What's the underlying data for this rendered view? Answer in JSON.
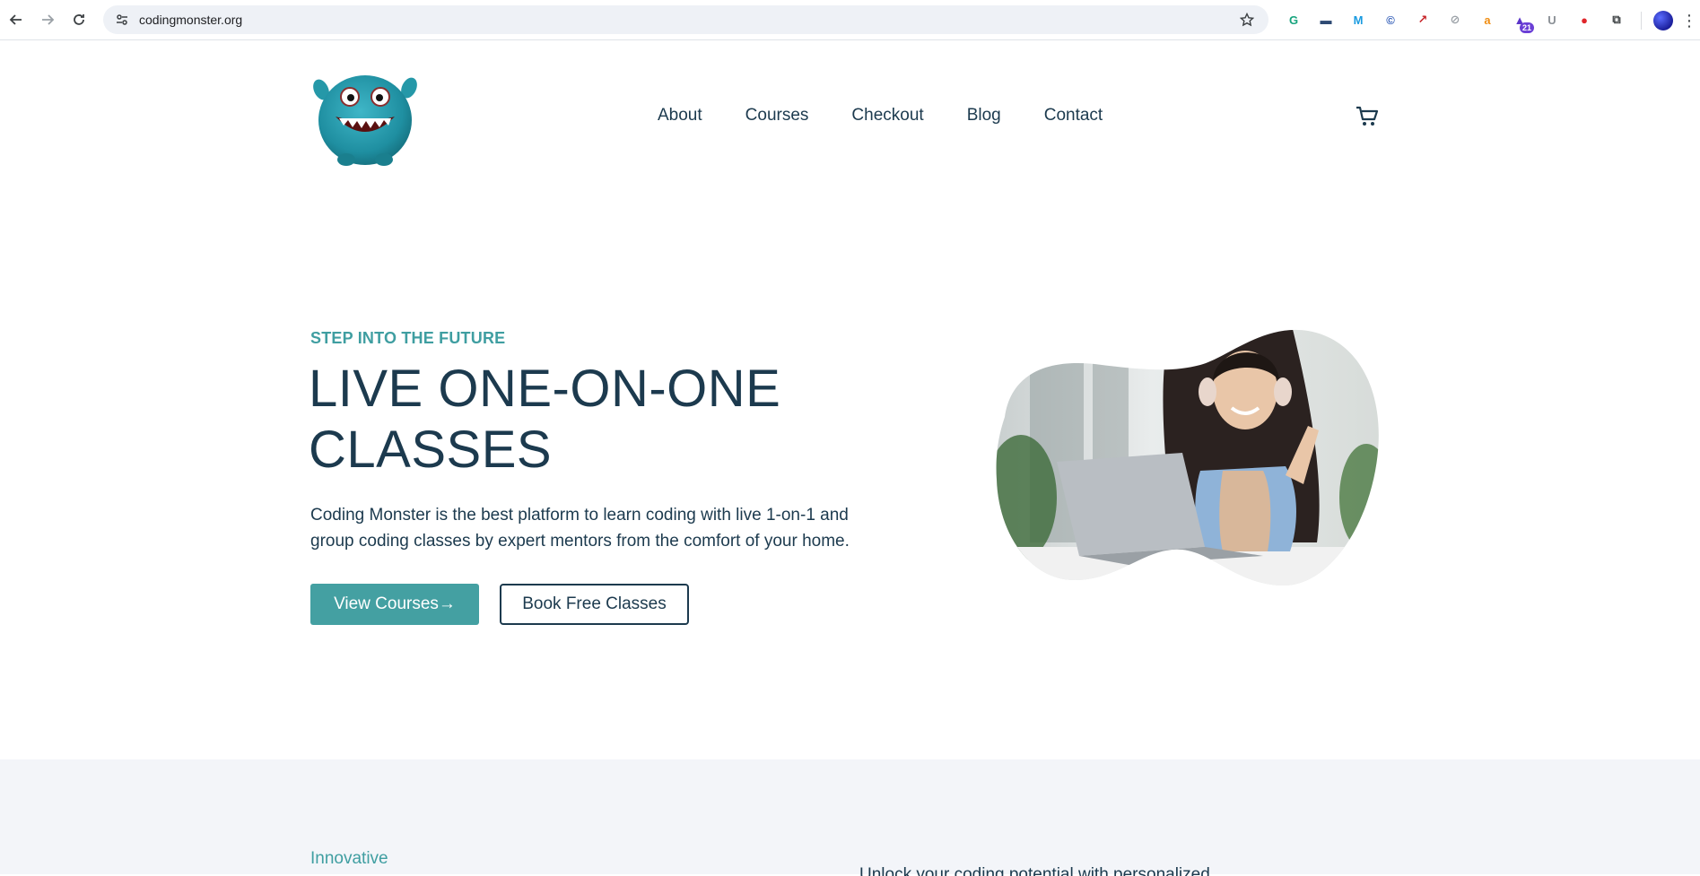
{
  "browser": {
    "url": "codingmonster.org",
    "extensions": [
      {
        "icon": "grammarly-icon",
        "color": "#15a37d",
        "glyph": "G"
      },
      {
        "icon": "clapperboard-icon",
        "color": "#2d4a73",
        "glyph": "▬"
      },
      {
        "icon": "mail-m-icon",
        "color": "#1a9be0",
        "glyph": "M"
      },
      {
        "icon": "copyright-c-icon",
        "color": "#2f5bb7",
        "glyph": "©"
      },
      {
        "icon": "pdf-icon",
        "color": "#c7262b",
        "glyph": "↗"
      },
      {
        "icon": "compass-icon",
        "color": "#9aa0a6",
        "glyph": "⊘"
      },
      {
        "icon": "amazon-icon",
        "color": "#f08d12",
        "glyph": "a"
      },
      {
        "icon": "graduation-cap-icon",
        "color": "#5b35c9",
        "glyph": "▲",
        "badge": "21"
      },
      {
        "icon": "u-letter-icon",
        "color": "#8a8f95",
        "glyph": "U"
      },
      {
        "icon": "map-pin-icon",
        "color": "#e0262b",
        "glyph": "●"
      },
      {
        "icon": "puzzle-piece-icon",
        "color": "#3c4043",
        "glyph": "⧉"
      }
    ]
  },
  "header": {
    "nav": [
      "About",
      "Courses",
      "Checkout",
      "Blog",
      "Contact"
    ]
  },
  "hero": {
    "eyebrow": "STEP INTO THE FUTURE",
    "title": "LIVE ONE-ON-ONE CLASSES",
    "description": "Coding Monster is the best platform to learn coding with live 1-on-1 and group coding classes by expert mentors from the comfort of your home.",
    "primary_button": "View Courses→",
    "secondary_button": "Book Free Classes"
  },
  "section2": {
    "label": "Innovative",
    "text": "Unlock your coding potential with personalized"
  },
  "colors": {
    "teal": "#44a0a2",
    "navy": "#1c3a4e",
    "section_bg": "#f3f5f9"
  }
}
